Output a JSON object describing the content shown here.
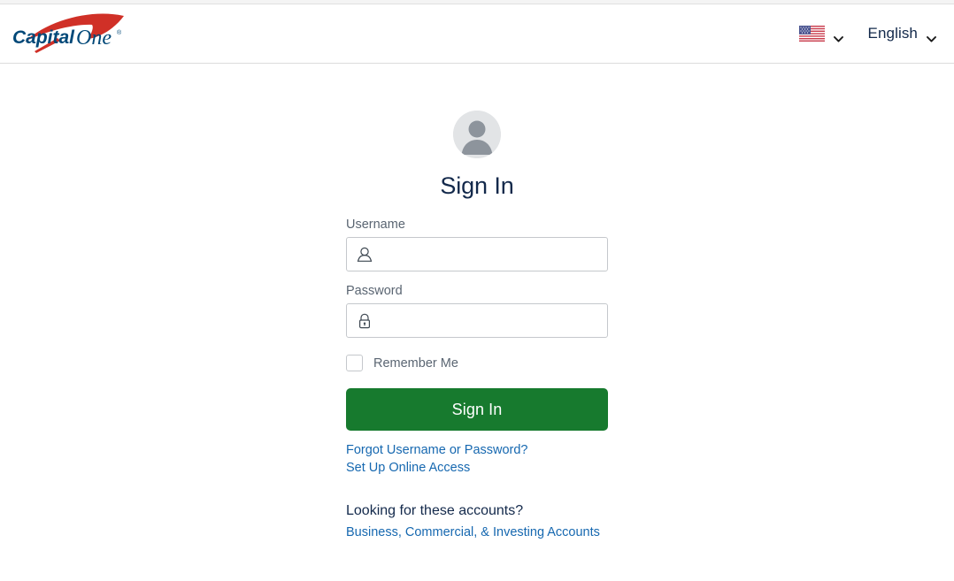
{
  "header": {
    "logo": {
      "name": "capital-one-logo",
      "text_primary": "Capital",
      "text_secondary": "One",
      "trademark": "®",
      "swoosh_color": "#d03027",
      "wordmark_color": "#004878"
    },
    "country_selector": {
      "icon": "us-flag-icon",
      "chevron": "chevron-down-icon"
    },
    "language_selector": {
      "label": "English",
      "chevron": "chevron-down-icon"
    }
  },
  "main": {
    "avatar_icon": "user-avatar-icon",
    "title": "Sign In",
    "form": {
      "username": {
        "label": "Username",
        "value": "",
        "placeholder": "",
        "icon": "user-icon"
      },
      "password": {
        "label": "Password",
        "value": "",
        "placeholder": "",
        "icon": "lock-icon"
      },
      "remember_me": {
        "label": "Remember Me",
        "checked": false
      },
      "submit_label": "Sign In"
    },
    "links": [
      {
        "label": "Forgot Username or Password?"
      },
      {
        "label": "Set Up Online Access"
      }
    ],
    "accounts": {
      "title": "Looking for these accounts?",
      "link_label": "Business, Commercial, & Investing Accounts"
    }
  },
  "colors": {
    "brand_blue": "#13294b",
    "link_blue": "#1668b0",
    "button_green": "#177a2e",
    "logo_red": "#d03027"
  }
}
